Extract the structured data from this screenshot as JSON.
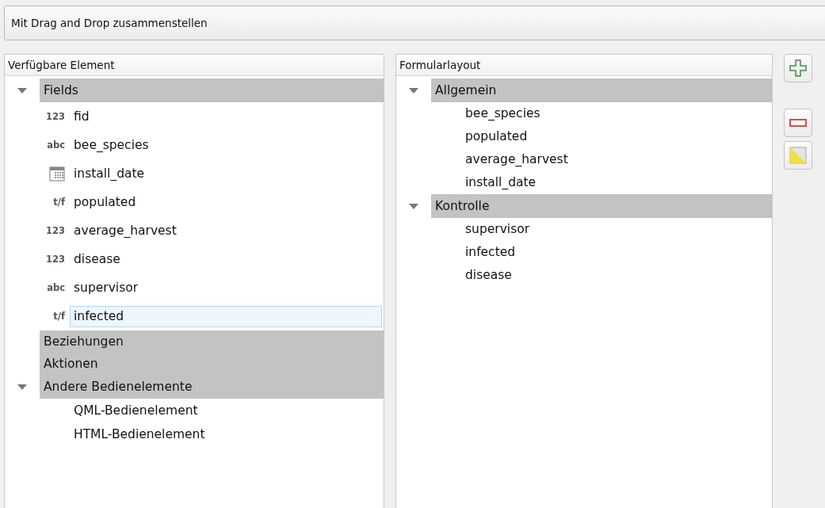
{
  "mode_selector": {
    "label": "Mit Drag and Drop zusammenstellen"
  },
  "available": {
    "header": "Verfügbare Element",
    "groups": [
      {
        "label": "Fields",
        "children": [
          {
            "kind": "int",
            "type_label": "123",
            "label": "fid",
            "selected": false
          },
          {
            "kind": "text",
            "type_label": "abc",
            "label": "bee_species",
            "selected": false
          },
          {
            "kind": "date",
            "label": "install_date",
            "selected": false
          },
          {
            "kind": "bool",
            "type_label": "t/f",
            "label": "populated",
            "selected": false
          },
          {
            "kind": "int",
            "type_label": "123",
            "label": "average_harvest",
            "selected": false
          },
          {
            "kind": "int",
            "type_label": "123",
            "label": "disease",
            "selected": false
          },
          {
            "kind": "text",
            "type_label": "abc",
            "label": "supervisor",
            "selected": false
          },
          {
            "kind": "bool",
            "type_label": "t/f",
            "label": "infected",
            "selected": true
          }
        ]
      },
      {
        "label": "Beziehungen"
      },
      {
        "label": "Aktionen"
      },
      {
        "label": "Andere Bedienelemente",
        "children": [
          {
            "kind": "widget",
            "label": "QML-Bedienelement",
            "selected": false
          },
          {
            "kind": "widget",
            "label": "HTML-Bedienelement",
            "selected": false
          }
        ]
      }
    ]
  },
  "layout": {
    "header": "Formularlayout",
    "groups": [
      {
        "label": "Allgemein",
        "children": [
          "bee_species",
          "populated",
          "average_harvest",
          "install_date"
        ]
      },
      {
        "label": "Kontrolle",
        "children": [
          "supervisor",
          "infected",
          "disease"
        ]
      }
    ]
  },
  "actions": [
    {
      "kind": "add"
    },
    {
      "kind": "remove"
    },
    {
      "kind": "edit"
    }
  ]
}
